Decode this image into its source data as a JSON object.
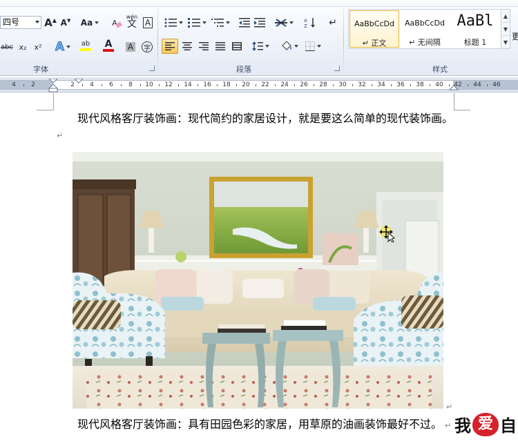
{
  "ribbon": {
    "font_group": {
      "label": "字体",
      "font_size": "四号",
      "grow_font": "A",
      "shrink_font": "A",
      "change_case": "Aa",
      "clear_format": "A",
      "phonetic": "wén",
      "phonetic_char": "文",
      "char_border": "A",
      "strike": "abc",
      "subscript": "x₂",
      "superscript": "x²",
      "text_effect": "A",
      "highlight": "ab",
      "font_color": "A",
      "char_shading": "A",
      "enclose_char": "字"
    },
    "paragraph_group": {
      "label": "段落"
    },
    "styles_group": {
      "label": "样式",
      "items": [
        {
          "sample": "AaBbCcDd",
          "name": "↵ 正文"
        },
        {
          "sample": "AaBbCcDd",
          "name": "↵ 无间隔"
        },
        {
          "sample": "AaBl",
          "name": "标题 1"
        }
      ],
      "right_edge_char": "更"
    }
  },
  "ruler": {
    "labels": [
      "4",
      "2",
      "2",
      "4",
      "6",
      "8",
      "10",
      "12",
      "14",
      "16",
      "18",
      "20",
      "22",
      "24",
      "26",
      "28",
      "30",
      "32",
      "34",
      "36",
      "38",
      "40",
      "42",
      "44",
      "46"
    ]
  },
  "document": {
    "paragraph1": "现代风格客厅装饰画：现代简约的家居设计，就是要这么简单的现代装饰画。",
    "paragraph2": "现代风格客厅装饰画：具有田园色彩的家居，用草原的油画装饰最好不过。",
    "para_mark": "↵"
  },
  "watermark": {
    "text_before": "我",
    "heart_text": "爱",
    "text_after": "自"
  },
  "colors": {
    "accent_orange": "#f8c95e",
    "highlight_yellow": "#ffff00",
    "font_red": "#e01010",
    "wall": "#c9d2c3"
  }
}
